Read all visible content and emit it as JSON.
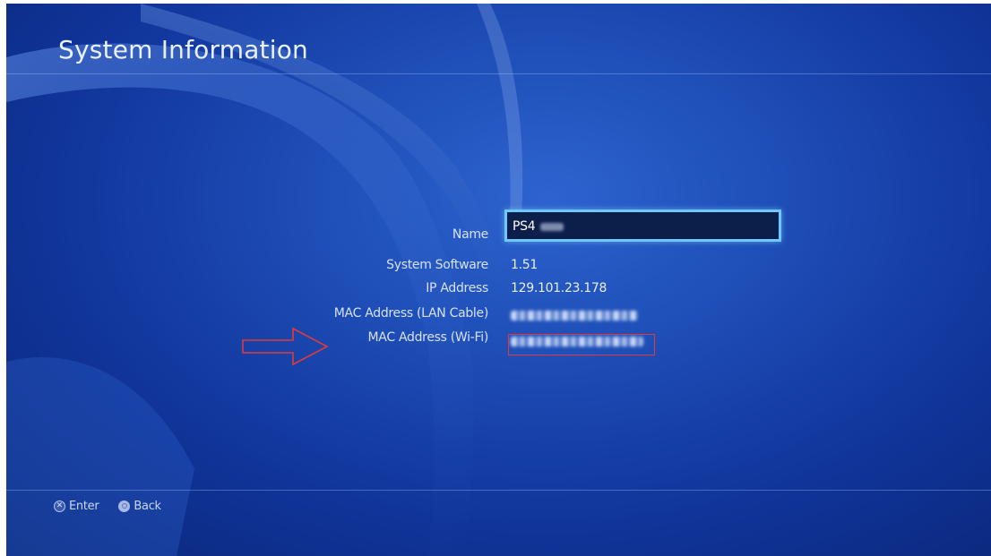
{
  "screen": {
    "title": "System Information"
  },
  "fields": [
    {
      "label": "Name",
      "value": "PS4"
    },
    {
      "label": "System Software",
      "value": "1.51"
    },
    {
      "label": "IP Address",
      "value": "129.101.23.178"
    },
    {
      "label": "MAC Address (LAN Cable)",
      "value": ""
    },
    {
      "label": "MAC Address (Wi-Fi)",
      "value": ""
    }
  ],
  "footer": {
    "enter_label": "Enter",
    "back_label": "Back",
    "enter_icon": "cross-button-icon",
    "back_icon": "circle-button-icon"
  },
  "annotations": {
    "highlight_color": "#e23a3a",
    "arrow_icon": "right-arrow-icon"
  },
  "colors": {
    "background": "#1c4bb3",
    "focus_border": "#6ec8ff",
    "text": "#e8efff"
  }
}
